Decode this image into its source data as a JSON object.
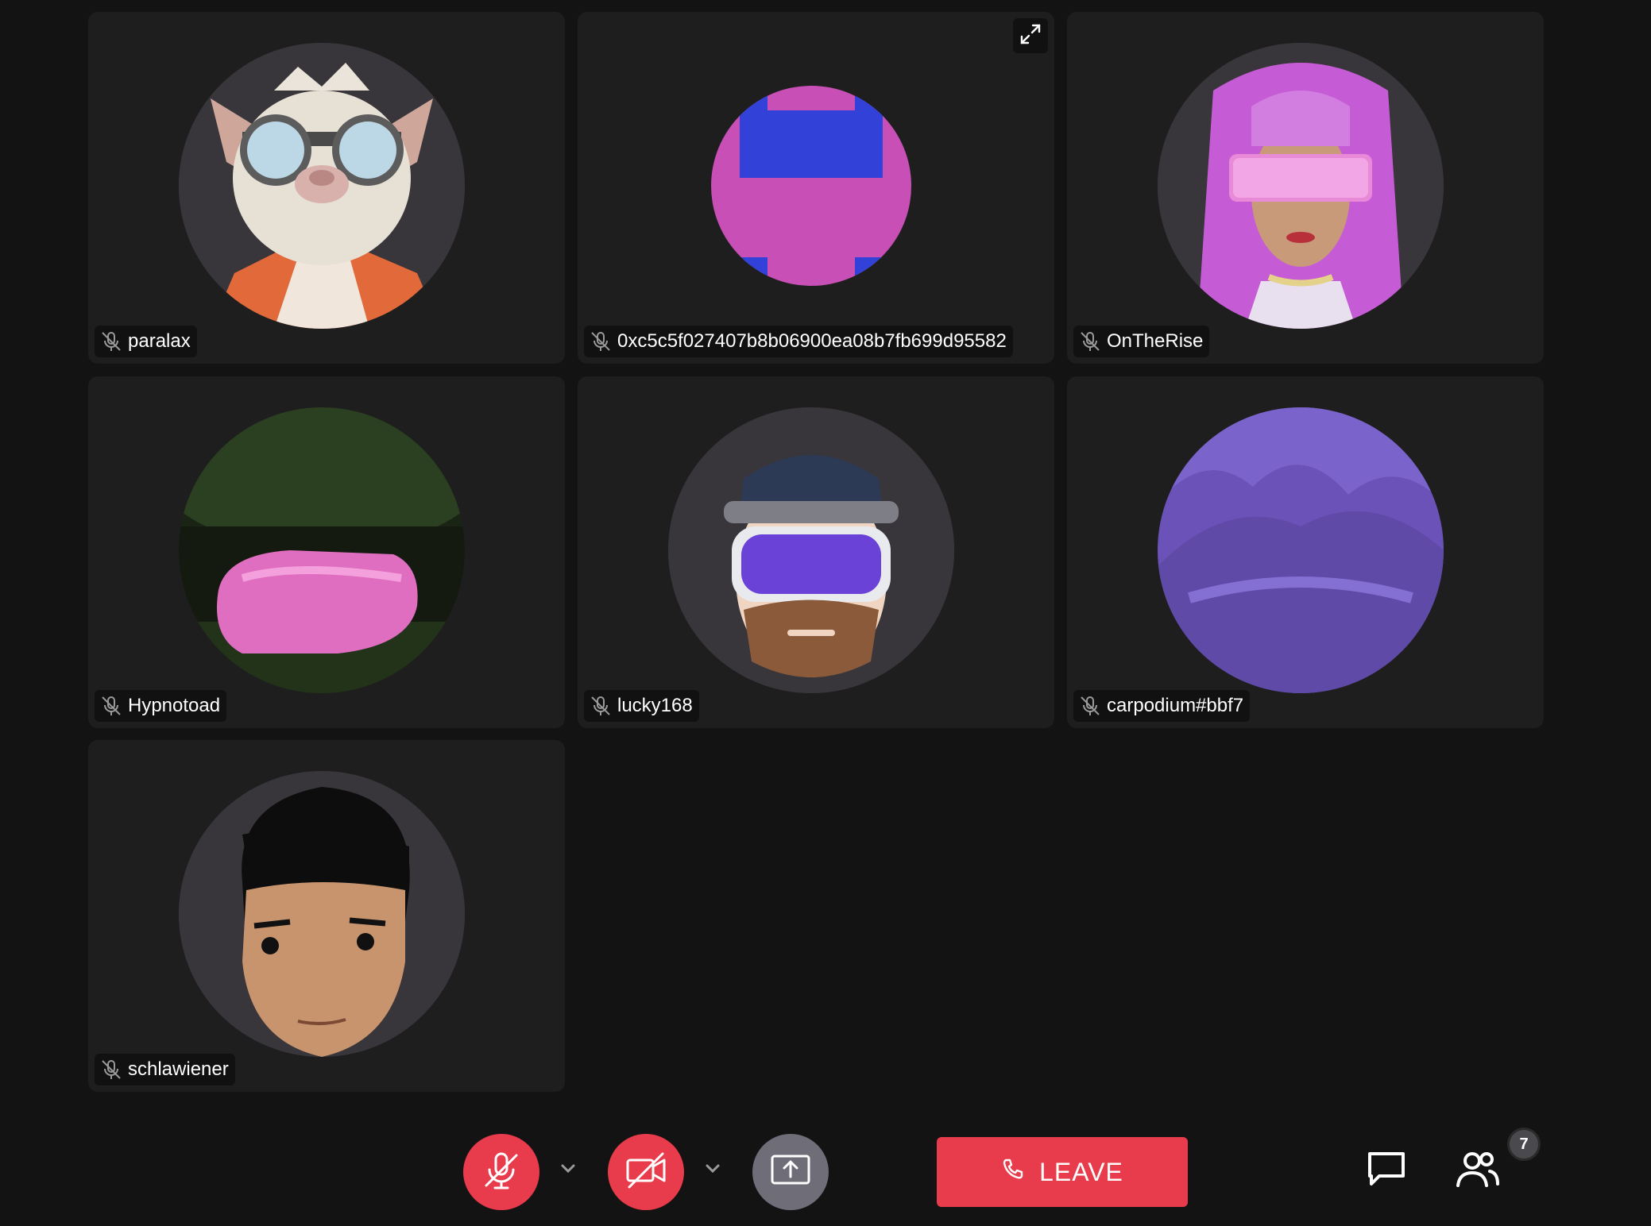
{
  "participants": [
    {
      "name": "paralax",
      "avatar": "raccoon-goggles-avatar",
      "muted": true
    },
    {
      "name": "0xc5c5f027407b8b06900ea08b7fb699d95582",
      "avatar": "pink-blue-pattern-avatar",
      "muted": true
    },
    {
      "name": "OnTheRise",
      "avatar": "pink-hair-visor-avatar",
      "muted": true
    },
    {
      "name": "Hypnotoad",
      "avatar": "green-pink-avatar",
      "muted": true
    },
    {
      "name": "lucky168",
      "avatar": "cap-goggles-beard-avatar",
      "muted": true
    },
    {
      "name": "carpodium#bbf7",
      "avatar": "purple-avatar",
      "muted": true
    },
    {
      "name": "schlawiener",
      "avatar": "black-hair-avatar",
      "muted": true
    }
  ],
  "toolbar": {
    "leave_label": "LEAVE",
    "participant_count": "7",
    "mic_state": "muted",
    "camera_state": "off"
  },
  "colors": {
    "background": "#131313",
    "tile": "#1e1e1e",
    "danger": "#e83b4b",
    "share_button": "#6e6d78"
  }
}
